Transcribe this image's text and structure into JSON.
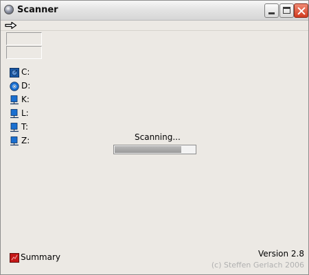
{
  "window": {
    "title": "Scanner"
  },
  "toolbar": {
    "back_icon": "arrow-right-icon"
  },
  "drives": [
    {
      "letter": "C:",
      "icon": "hard-drive-icon"
    },
    {
      "letter": "D:",
      "icon": "cd-rom-icon"
    },
    {
      "letter": "K:",
      "icon": "network-drive-icon"
    },
    {
      "letter": "L:",
      "icon": "network-drive-icon"
    },
    {
      "letter": "T:",
      "icon": "network-drive-icon"
    },
    {
      "letter": "Z:",
      "icon": "network-drive-icon"
    }
  ],
  "status": {
    "text": "Scanning...",
    "progress_percent": 83
  },
  "summary": {
    "label": "Summary",
    "icon": "summary-icon"
  },
  "footer": {
    "version": "Version 2.8",
    "copyright": "(c) Steffen Gerlach 2006"
  },
  "colors": {
    "drive_blue": "#1a5aa8",
    "summary_red": "#c41818",
    "progress_fill": "#a8a8a8"
  }
}
